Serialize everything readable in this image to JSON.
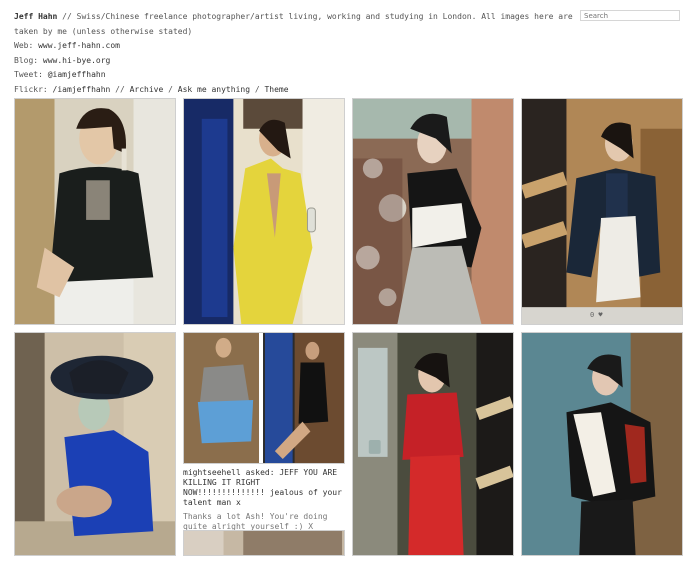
{
  "header": {
    "name": "Jeff Hahn",
    "bio": " // Swiss/Chinese freelance photographer/artist living, working and studying in London. All images here are taken by me (unless otherwise stated)",
    "web_label": "Web: ",
    "web_value": "www.jeff-hahn.com",
    "blog_label": "Blog: ",
    "blog_value": "www.hi-bye.org",
    "tweet_label": "Tweet: ",
    "tweet_value": "@iamjeffhahn",
    "flickr_label": "Flickr: ",
    "flickr_value": "/iamjeffhahn",
    "sep": " // ",
    "archive": "Archive",
    "slash": " / ",
    "ask": "Ask me anything",
    "theme": "Theme"
  },
  "search": {
    "placeholder": "Search"
  },
  "post_meta": {
    "notes": "0 ♥"
  },
  "ask_post": {
    "question": "mightseehell asked: JEFF YOU ARE KILLING IT RIGHT NOW!!!!!!!!!!!!!! jealous of your talent man x",
    "answer": "Thanks a lot Ash! You're doing quite alright yourself :) X"
  },
  "colors": {
    "text": "#444444",
    "border": "#cfcfcf",
    "background": "#ffffff"
  }
}
